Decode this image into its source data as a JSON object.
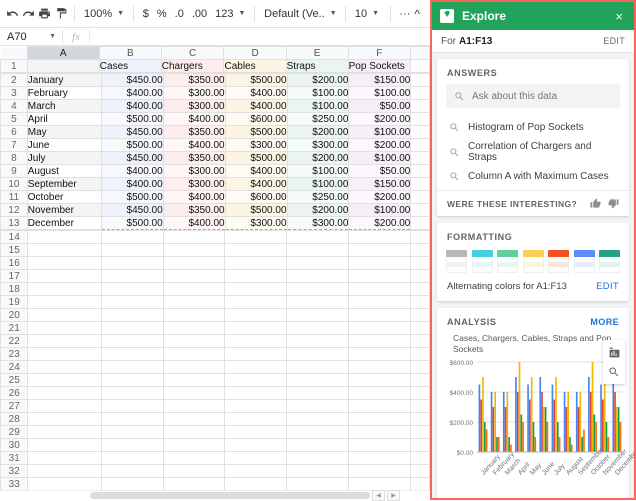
{
  "toolbar": {
    "icons": [
      "undo-icon",
      "redo-icon",
      "print-icon",
      "paint-format-icon"
    ],
    "zoom": "100%",
    "currency": "$",
    "percent": "%",
    "dec_less": ".0",
    "dec_more": ".00",
    "format_123": "123",
    "font": "Default (Ve..",
    "font_size": "10",
    "more": "···",
    "collapse": "^"
  },
  "formula_bar": {
    "name_box": "A70",
    "fx": "fx",
    "value": ""
  },
  "sheet": {
    "column_headers": [
      "A",
      "B",
      "C",
      "D",
      "E",
      "F"
    ],
    "selected_column": "A",
    "header_row": [
      "",
      "Cases",
      "Chargers",
      "Cables",
      "Straps",
      "Pop Sockets"
    ],
    "rows": [
      {
        "n": 2,
        "cells": [
          "January",
          "$450.00",
          "$350.00",
          "$500.00",
          "$200.00",
          "$150.00"
        ]
      },
      {
        "n": 3,
        "cells": [
          "February",
          "$400.00",
          "$300.00",
          "$400.00",
          "$100.00",
          "$100.00"
        ]
      },
      {
        "n": 4,
        "cells": [
          "March",
          "$400.00",
          "$300.00",
          "$400.00",
          "$100.00",
          "$50.00"
        ]
      },
      {
        "n": 5,
        "cells": [
          "April",
          "$500.00",
          "$400.00",
          "$600.00",
          "$250.00",
          "$200.00"
        ]
      },
      {
        "n": 6,
        "cells": [
          "May",
          "$450.00",
          "$350.00",
          "$500.00",
          "$200.00",
          "$100.00"
        ]
      },
      {
        "n": 7,
        "cells": [
          "June",
          "$500.00",
          "$400.00",
          "$300.00",
          "$300.00",
          "$200.00"
        ]
      },
      {
        "n": 8,
        "cells": [
          "July",
          "$450.00",
          "$350.00",
          "$500.00",
          "$200.00",
          "$100.00"
        ]
      },
      {
        "n": 9,
        "cells": [
          "August",
          "$400.00",
          "$300.00",
          "$400.00",
          "$100.00",
          "$50.00"
        ]
      },
      {
        "n": 10,
        "cells": [
          "September",
          "$400.00",
          "$300.00",
          "$400.00",
          "$100.00",
          "$150.00"
        ]
      },
      {
        "n": 11,
        "cells": [
          "October",
          "$500.00",
          "$400.00",
          "$600.00",
          "$250.00",
          "$200.00"
        ]
      },
      {
        "n": 12,
        "cells": [
          "November",
          "$450.00",
          "$350.00",
          "$500.00",
          "$200.00",
          "$100.00"
        ]
      },
      {
        "n": 13,
        "cells": [
          "December",
          "$500.00",
          "$400.00",
          "$300.00",
          "$300.00",
          "$200.00"
        ]
      }
    ],
    "empty_rows": [
      14,
      15,
      16,
      17,
      18,
      19,
      20,
      21,
      22,
      23,
      24,
      25,
      26,
      27,
      28,
      29,
      30,
      31,
      32,
      33
    ],
    "header_row_number": "1"
  },
  "explore": {
    "title": "Explore",
    "close": "×",
    "range_prefix": "For",
    "range": "A1:F13",
    "edit": "EDIT",
    "answers": {
      "heading": "ANSWERS",
      "ask_placeholder": "Ask about this data",
      "suggestions": [
        "Histogram of Pop Sockets",
        "Correlation of Chargers and Straps",
        "Column A with Maximum Cases"
      ],
      "feedback_label": "WERE THESE INTERESTING?"
    },
    "formatting": {
      "heading": "FORMATTING",
      "swatches": [
        "#b7b7b7",
        "#45cfe0",
        "#5fd09a",
        "#f9cf55",
        "#f4511e",
        "#5c8cf5",
        "#27a08a"
      ],
      "swatch_tints": [
        "#f1f1f1",
        "#e4f6f9",
        "#e7f6ee",
        "#fbf3dd",
        "#fce5de",
        "#e4ecfd",
        "#e0f1ee"
      ],
      "caption": "Alternating colors for A1:F13",
      "edit": "EDIT"
    },
    "analysis": {
      "heading": "ANALYSIS",
      "more": "MORE",
      "tools": [
        "insert-chart-icon",
        "zoom-chart-icon"
      ]
    }
  },
  "chart_data": {
    "type": "bar",
    "title": "Cases, Chargers, Cables, Straps and Pop Sockets",
    "xlabel": "",
    "ylabel": "",
    "ylim": [
      0,
      600
    ],
    "yticks": [
      "$0.00",
      "$200.00",
      "$400.00",
      "$600.00"
    ],
    "grid": true,
    "legend": "none",
    "categories": [
      "January",
      "February",
      "March",
      "April",
      "May",
      "June",
      "July",
      "August",
      "September",
      "October",
      "November",
      "December"
    ],
    "series": [
      {
        "name": "Cases",
        "color": "#4285f4",
        "values": [
          450,
          400,
          400,
          500,
          450,
          500,
          450,
          400,
          400,
          500,
          450,
          500
        ]
      },
      {
        "name": "Chargers",
        "color": "#db4437",
        "values": [
          350,
          300,
          300,
          400,
          350,
          400,
          350,
          300,
          300,
          400,
          350,
          400
        ]
      },
      {
        "name": "Cables",
        "color": "#f4b400",
        "values": [
          500,
          400,
          400,
          600,
          500,
          300,
          500,
          400,
          400,
          600,
          500,
          300
        ]
      },
      {
        "name": "Straps",
        "color": "#0f9d58",
        "values": [
          200,
          100,
          100,
          250,
          200,
          300,
          200,
          100,
          100,
          250,
          200,
          300
        ]
      },
      {
        "name": "Pop Sockets",
        "color": "#ff6d00",
        "values": [
          150,
          100,
          50,
          200,
          100,
          200,
          100,
          50,
          150,
          200,
          100,
          200
        ]
      }
    ]
  }
}
